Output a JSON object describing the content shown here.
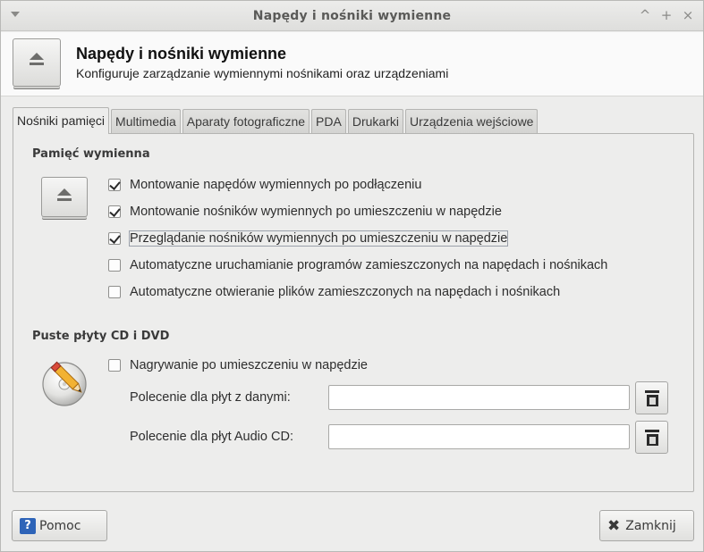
{
  "window": {
    "title": "Napędy i nośniki wymienne",
    "buttons": {
      "minimize": "^",
      "maximize": "+",
      "close": "×"
    }
  },
  "header": {
    "title": "Napędy i nośniki wymienne",
    "subtitle": "Konfiguruje zarządzanie wymiennymi nośnikami oraz urządzeniami",
    "icon": "eject-icon"
  },
  "tabs": [
    {
      "label": "Nośniki pamięci",
      "active": true
    },
    {
      "label": "Multimedia",
      "active": false
    },
    {
      "label": "Aparaty fotograficzne",
      "active": false
    },
    {
      "label": "PDA",
      "active": false
    },
    {
      "label": "Drukarki",
      "active": false
    },
    {
      "label": "Urządzenia wejściowe",
      "active": false
    }
  ],
  "removable_storage": {
    "heading": "Pamięć wymienna",
    "icon": "eject-icon",
    "options": [
      {
        "label": "Montowanie napędów wymiennych po podłączeniu",
        "checked": true
      },
      {
        "label": "Montowanie nośników wymiennych po umieszczeniu w napędzie",
        "checked": true
      },
      {
        "label": "Przeglądanie nośników wymiennych po umieszczeniu w napędzie",
        "checked": true,
        "focused": true
      },
      {
        "label": "Automatyczne uruchamianie programów zamieszczonych na napędach i nośnikach",
        "checked": false
      },
      {
        "label": "Automatyczne otwieranie plików zamieszczonych na napędach i nośnikach",
        "checked": false
      }
    ]
  },
  "blank_discs": {
    "heading": "Puste płyty CD i DVD",
    "icon": "disc-burn-icon",
    "burn_option": {
      "label": "Nagrywanie po umieszczeniu w napędzie",
      "checked": false
    },
    "data_command": {
      "label": "Polecenie dla płyt z danymi:",
      "value": ""
    },
    "audio_command": {
      "label": "Polecenie dla płyt Audio CD:",
      "value": ""
    }
  },
  "footer": {
    "help_label": "Pomoc",
    "help_icon_glyph": "?",
    "close_label": "Zamknij",
    "close_icon_glyph": "✖"
  },
  "colors": {
    "accent": "#2e64b8",
    "window_bg": "#ededec",
    "header_bg": "#fafafa"
  }
}
